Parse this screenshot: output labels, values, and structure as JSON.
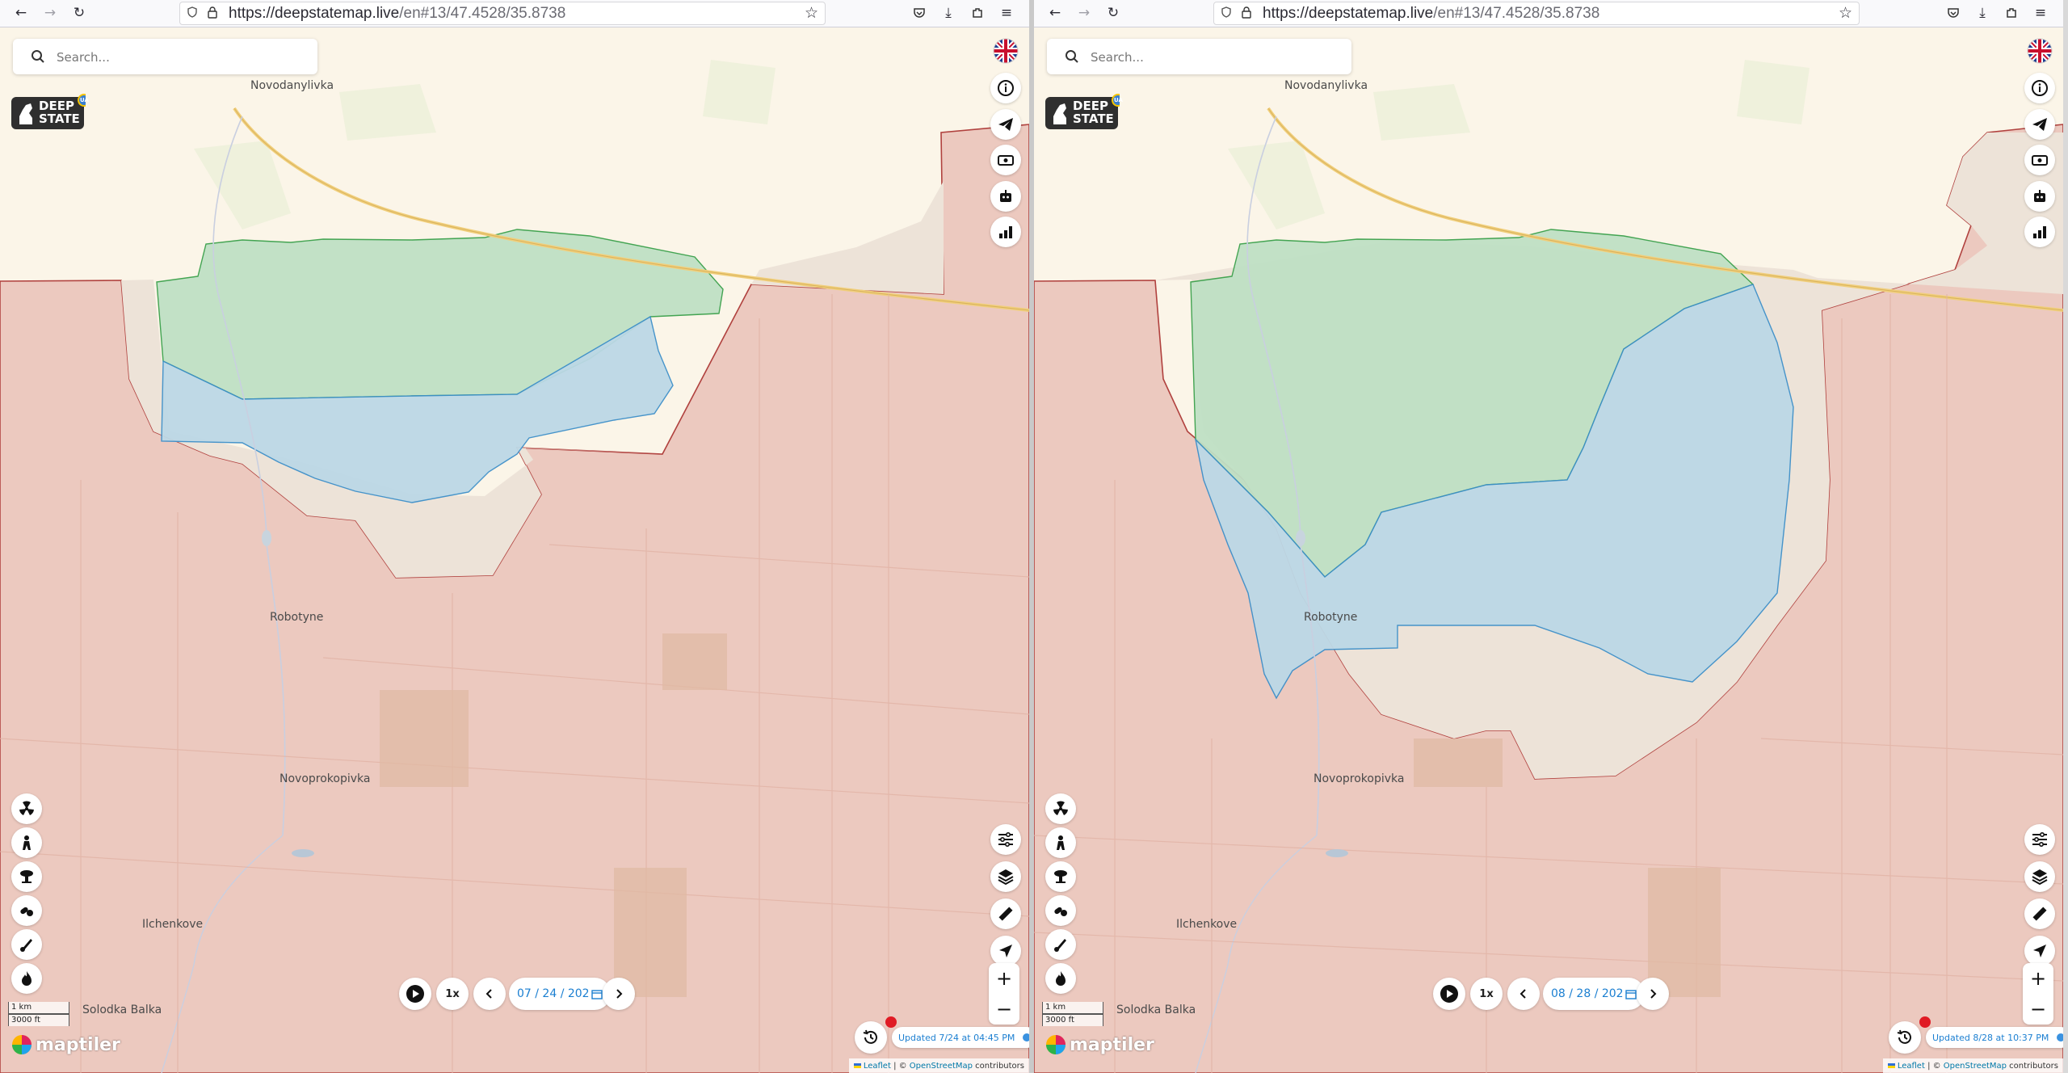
{
  "panes": [
    {
      "url_host": "https://deepstatemap.live",
      "url_path": "/en#13/47.4528/35.8738",
      "search_placeholder": "Search...",
      "logo_text": [
        "DEEP",
        "STATE"
      ],
      "logo_badge": "UA",
      "places": [
        {
          "id": "novodanylivka",
          "name": "Novodanylivka"
        },
        {
          "id": "robotyne",
          "name": "Robotyne"
        },
        {
          "id": "novoprokopivka",
          "name": "Novoprokopivka"
        },
        {
          "id": "ilchenkove",
          "name": "Ilchenkove"
        },
        {
          "id": "solodka-balka",
          "name": "Solodka Balka"
        }
      ],
      "speed_label": "1x",
      "date_value": "07 / 24 / 202",
      "updated_text": "Updated 7/24 at 04:45 PM",
      "scale_metric": "1 km",
      "scale_imperial": "3000 ft",
      "maptiler_label": "maptiler",
      "attribution": {
        "leaflet": "Leaflet",
        "sep": " | © ",
        "osm": "OpenStreetMap",
        "tail": " contributors"
      },
      "zoom_in": "+",
      "zoom_out": "−"
    },
    {
      "url_host": "https://deepstatemap.live",
      "url_path": "/en#13/47.4528/35.8738",
      "search_placeholder": "Search...",
      "logo_text": [
        "DEEP",
        "STATE"
      ],
      "logo_badge": "UA",
      "places": [
        {
          "id": "novodanylivka",
          "name": "Novodanylivka"
        },
        {
          "id": "robotyne",
          "name": "Robotyne"
        },
        {
          "id": "novoprokopivka",
          "name": "Novoprokopivka"
        },
        {
          "id": "ilchenkove",
          "name": "Ilchenkove"
        },
        {
          "id": "solodka-balka",
          "name": "Solodka Balka"
        }
      ],
      "speed_label": "1x",
      "date_value": "08 / 28 / 202",
      "updated_text": "Updated 8/28 at 10:37 PM",
      "scale_metric": "1 km",
      "scale_imperial": "3000 ft",
      "maptiler_label": "maptiler",
      "attribution": {
        "leaflet": "Leaflet",
        "sep": " | © ",
        "osm": "OpenStreetMap",
        "tail": " contributors"
      },
      "zoom_in": "+",
      "zoom_out": "−"
    }
  ],
  "colors": {
    "occupied": "#ecc9bf",
    "occupied_border": "#b0413e",
    "liberated": "#bfe0c5",
    "liberated_border": "#3aa04a",
    "contested": "#bcd8e6",
    "contested_border": "#3d8fc9",
    "grey_zone": "#ede3d8",
    "background": "#fbf5e8",
    "accent": "#1b7fd1"
  },
  "icons": {
    "right_column": [
      "uk-flag-icon",
      "info-icon",
      "telegram-icon",
      "donate-icon",
      "robot-icon",
      "chart-icon"
    ],
    "left_column": [
      "radiation-icon",
      "soldier-icon",
      "explosion-icon",
      "pills-icon",
      "artillery-icon",
      "fire-icon"
    ],
    "right_lower": [
      "filters-icon",
      "layers-icon",
      "ruler-icon",
      "locate-icon"
    ]
  }
}
